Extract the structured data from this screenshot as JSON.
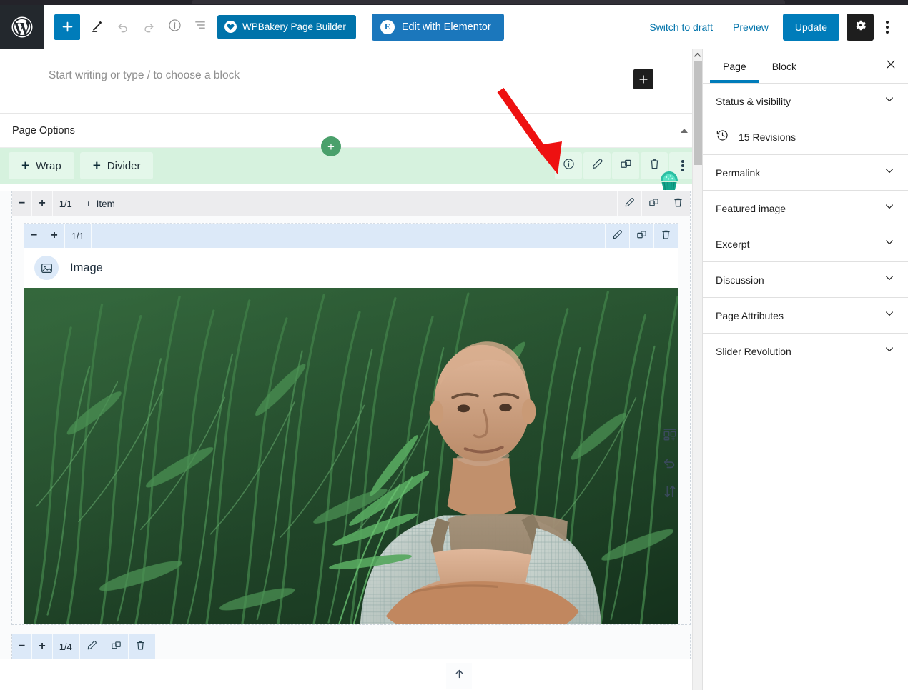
{
  "topbar": {
    "logo_icon": "wordpress-logo-icon",
    "add_block_label": "+",
    "edit_pencil_icon": "pencil-icon",
    "undo_icon": "undo-icon",
    "redo_icon": "redo-icon",
    "info_icon": "info-icon",
    "list_view_icon": "list-view-icon",
    "wpbakery_label": "WPBakery Page Builder",
    "elementor_label": "Edit with Elementor",
    "elementor_badge": "E",
    "switch_to_draft": "Switch to draft",
    "preview": "Preview",
    "update": "Update",
    "settings_icon": "gear-icon",
    "more_icon": "kebab-menu-icon"
  },
  "editor": {
    "prompt_placeholder": "Start writing or type / to choose a block",
    "prompt_add_icon": "plus-icon",
    "page_options_title": "Page Options",
    "page_options_collapse_icon": "caret-up-icon",
    "green_bar": {
      "add_plus_label": "+",
      "chips": [
        {
          "label": "Wrap",
          "plus": "+"
        },
        {
          "label": "Divider",
          "plus": "+"
        }
      ],
      "actions": [
        {
          "name": "info-icon"
        },
        {
          "name": "edit-pencil-icon"
        },
        {
          "name": "duplicate-icon"
        },
        {
          "name": "delete-icon"
        },
        {
          "name": "more-kebab-icon"
        }
      ],
      "background": "#d6f2de"
    },
    "row_outer": {
      "minus": "−",
      "plus": "+",
      "fraction": "1/1",
      "item_label": "Item",
      "item_plus": "+",
      "actions": [
        "edit-pencil-icon",
        "duplicate-icon",
        "delete-icon"
      ]
    },
    "row_inner": {
      "minus": "−",
      "plus": "+",
      "fraction": "1/1",
      "actions": [
        "edit-pencil-icon",
        "duplicate-icon",
        "delete-icon"
      ]
    },
    "image_block": {
      "icon": "image-placeholder-icon",
      "label": "Image",
      "alt_description": "Older bald man with crossed arms standing in a tall green hemp field"
    },
    "row_bottom": {
      "minus": "−",
      "plus": "+",
      "fraction": "1/4",
      "actions": [
        "edit-pencil-icon",
        "duplicate-icon",
        "delete-icon"
      ]
    },
    "scroll_top_icon": "arrow-up-icon",
    "rail_icons": [
      {
        "name": "cupcake-icon",
        "color": "#2bbfa3"
      },
      {
        "name": "add-template-icon"
      },
      {
        "name": "undo-icon"
      },
      {
        "name": "reorder-icon"
      }
    ]
  },
  "sidebar": {
    "tabs": [
      {
        "label": "Page",
        "active": true
      },
      {
        "label": "Block",
        "active": false
      }
    ],
    "close_icon": "close-icon",
    "panels": [
      {
        "label": "Status & visibility",
        "icon": "chevron-down-icon"
      },
      {
        "label": "15 Revisions",
        "icon": "revisions-clock-icon",
        "type": "revisions"
      },
      {
        "label": "Permalink",
        "icon": "chevron-down-icon"
      },
      {
        "label": "Featured image",
        "icon": "chevron-down-icon"
      },
      {
        "label": "Excerpt",
        "icon": "chevron-down-icon"
      },
      {
        "label": "Discussion",
        "icon": "chevron-down-icon"
      },
      {
        "label": "Page Attributes",
        "icon": "chevron-down-icon"
      },
      {
        "label": "Slider Revolution",
        "icon": "chevron-down-icon"
      }
    ]
  },
  "annotation": {
    "arrow_icon": "red-arrow-annotation",
    "color": "#ee1111"
  },
  "colors": {
    "accent_blue": "#007cba",
    "elementor_blue": "#1b77bc",
    "wpbakery_blue": "#0073aa",
    "green_bar": "#d6f2de",
    "green_button": "#4aa06b",
    "row_blue": "#dce9f8",
    "row_grey": "#ececee"
  }
}
